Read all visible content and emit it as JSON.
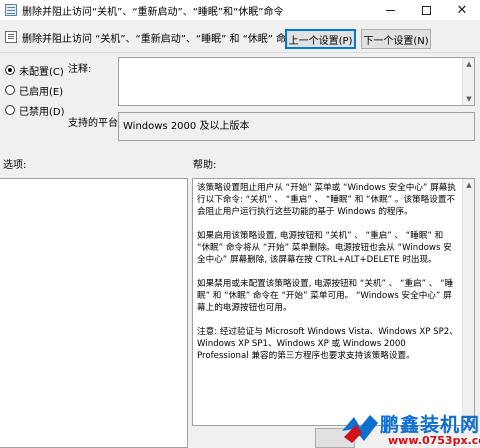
{
  "window": {
    "title": "删除并阻止访问“关机”、“重新启动”、“睡眠”和“休眠”命令",
    "controls": [
      "minimize",
      "maximize",
      "close"
    ]
  },
  "header": {
    "policy_name": "删除并阻止访问 “关机”、“重新启动”、“睡眠” 和 “休眠” 命令",
    "prev_button": "上一个设置(P)",
    "next_button": "下一个设置(N)"
  },
  "radios": [
    {
      "label": "未配置(C)",
      "checked": true
    },
    {
      "label": "已启用(E)",
      "checked": false
    },
    {
      "label": "已禁用(D)",
      "checked": false
    }
  ],
  "labels": {
    "comment": "注释:",
    "supported": "支持的平台:",
    "options": "选项:",
    "help": "帮助:"
  },
  "supported_value": "Windows 2000 及以上版本",
  "help_paragraphs": [
    "该策略设置阻止用户从 “开始” 菜单或 “Windows 安全中心” 屏幕执行以下命令: “关机” 、 “重启” 、 “睡眠” 和 “休眠” 。该策略设置不会阻止用户运行执行这些功能的基于 Windows 的程序。",
    "如果启用该策略设置, 电源按钮和 “关机” 、 “重启” 、 “睡眠” 和 “休眠” 命令将从 “开始” 菜单删除。电源按钮也会从 “Windows 安全中心” 屏幕删除, 该屏幕在按 CTRL+ALT+DELETE 时出现。",
    "如果禁用或未配置该策略设置, 电源按钮和 “关机” 、 “重启” 、 “睡眠” 和 “休眠” 命令在 “开始” 菜单可用。 “Windows 安全中心” 屏幕上的电源按钮也可用。",
    "注意: 经过验证与 Microsoft Windows Vista、Windows XP SP2、Windows XP SP1、Windows XP 或 Windows 2000 Professional 兼容的第三方程序也要求支持该策略设置。"
  ],
  "watermark": {
    "title": "鹏鑫装机网",
    "url": "www.0753px.com",
    "colors": {
      "title": "#0d6fd0",
      "url": "#d0101a"
    }
  }
}
